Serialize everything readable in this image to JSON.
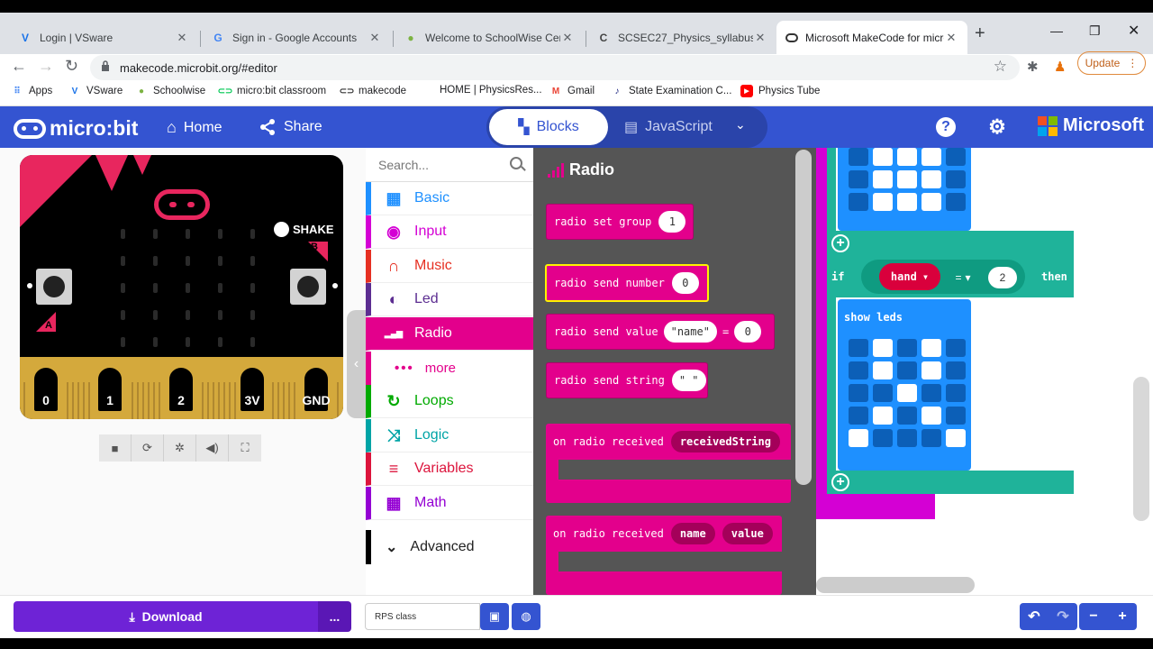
{
  "browser": {
    "tabs": [
      {
        "title": "Login | VSware",
        "favicon": "vsware-icon"
      },
      {
        "title": "Sign in - Google Accounts",
        "favicon": "google-icon"
      },
      {
        "title": "Welcome to SchoolWise Centr...",
        "favicon": "schoolwise-icon"
      },
      {
        "title": "SCSEC27_Physics_syllabus_eng...",
        "favicon": "google-c-icon"
      },
      {
        "title": "Microsoft MakeCode for micro...",
        "favicon": "makecode-icon"
      }
    ],
    "new_tab": "+",
    "url": "makecode.microbit.org/#editor",
    "update_label": "Update",
    "bookmarks": [
      "Apps",
      "VSware",
      "Schoolwise",
      "micro:bit classroom",
      "makecode",
      "HOME | PhysicsRes...",
      "Gmail",
      "State Examination C...",
      "Physics Tube"
    ]
  },
  "header": {
    "logo": "micro:bit",
    "home": "Home",
    "share": "Share",
    "mode_blocks": "Blocks",
    "mode_js": "JavaScript",
    "microsoft": "Microsoft"
  },
  "simulator": {
    "shake": "SHAKE",
    "button_a": "A",
    "button_b": "B",
    "pins": [
      "0",
      "1",
      "2",
      "3V",
      "GND"
    ]
  },
  "toolbox": {
    "search_placeholder": "Search...",
    "categories": [
      {
        "label": "Basic",
        "color": "#1e90ff",
        "icon": "grid-icon"
      },
      {
        "label": "Input",
        "color": "#d400d4",
        "icon": "target-icon"
      },
      {
        "label": "Music",
        "color": "#e63022",
        "icon": "headphones-icon"
      },
      {
        "label": "Led",
        "color": "#5c2d91",
        "icon": "toggle-icon"
      },
      {
        "label": "Radio",
        "color": "#e3008c",
        "icon": "signal-icon"
      },
      {
        "label": "Loops",
        "color": "#00aa00",
        "icon": "refresh-icon"
      },
      {
        "label": "Logic",
        "color": "#00a4a6",
        "icon": "shuffle-icon"
      },
      {
        "label": "Variables",
        "color": "#dc143c",
        "icon": "lines-icon"
      },
      {
        "label": "Math",
        "color": "#9400d3",
        "icon": "calculator-icon"
      }
    ],
    "more": "more",
    "advanced": "Advanced"
  },
  "flyout": {
    "title": "Radio",
    "blocks": {
      "set_group": {
        "text": "radio set group",
        "value": "1"
      },
      "send_number": {
        "text": "radio send number",
        "value": "0"
      },
      "send_value": {
        "text": "radio send value",
        "name": "\"name\"",
        "eq": "=",
        "value": "0"
      },
      "send_string": {
        "text": "radio send string",
        "value": "\" \""
      },
      "received_string": {
        "text": "on radio received",
        "var": "receivedString"
      },
      "received_name_value": {
        "text": "on radio received",
        "var1": "name",
        "var2": "value"
      }
    }
  },
  "workspace": {
    "if_label": "if",
    "hand_var": "hand",
    "operator": "=",
    "compare_value": "2",
    "then_label": "then",
    "show_leds_label": "show leds",
    "leds_top_partial": [
      0,
      1,
      1,
      1,
      0,
      0,
      1,
      1,
      1,
      0,
      0,
      1,
      1,
      1,
      0
    ],
    "leds": [
      0,
      1,
      0,
      1,
      0,
      0,
      1,
      0,
      1,
      0,
      0,
      0,
      1,
      0,
      0,
      0,
      1,
      0,
      1,
      0,
      1,
      0,
      0,
      0,
      1
    ]
  },
  "bottom": {
    "download": "Download",
    "more": "...",
    "project_name": "RPS class"
  }
}
